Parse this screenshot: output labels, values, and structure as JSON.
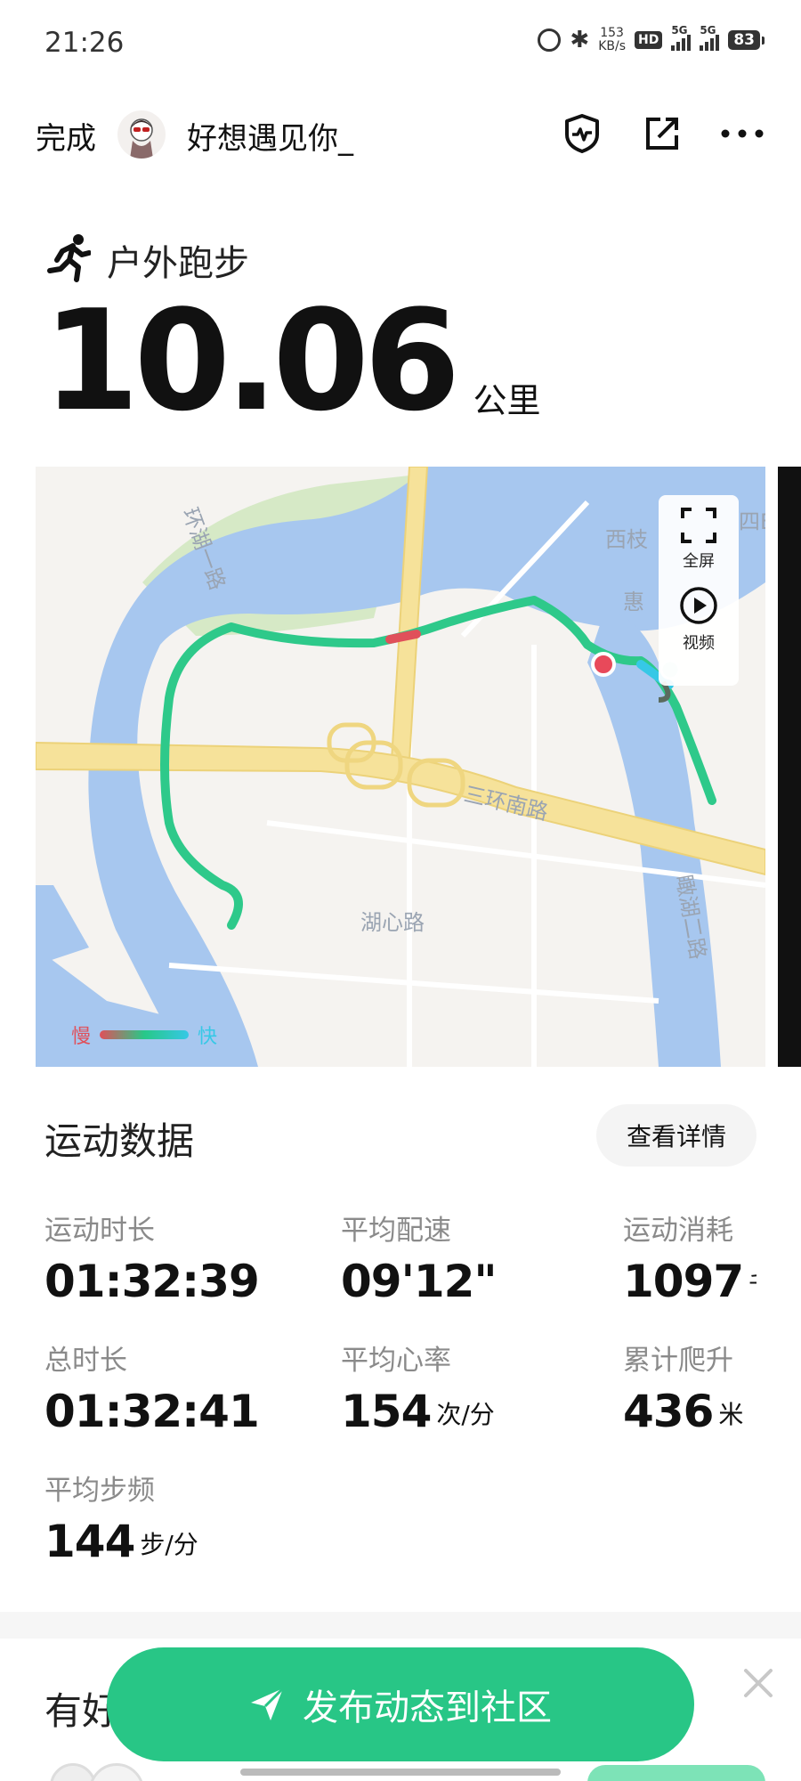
{
  "status_bar": {
    "time": "21:26",
    "speed_value": "153",
    "speed_unit": "KB/s",
    "hd_label": "HD",
    "signal_label": "5G",
    "battery": "83"
  },
  "nav": {
    "done_label": "完成",
    "username": "好想遇见你_"
  },
  "activity": {
    "type_label": "户外跑步",
    "distance": "10.06",
    "distance_unit": "公里"
  },
  "map": {
    "labels": {
      "road_huanhu": "环湖一路",
      "xizhi": "西枝",
      "huizhou_partial": "惠",
      "sanhuan": "三环南路",
      "huxin": "湖心路",
      "kanhu": "瞰湖二路",
      "top_right_partial": "四E"
    },
    "controls": {
      "fullscreen": "全屏",
      "video": "视频"
    },
    "legend": {
      "slow": "慢",
      "fast": "快"
    }
  },
  "stats": {
    "title": "运动数据",
    "details_button": "查看详情",
    "items": [
      {
        "label": "运动时长",
        "value": "01:32:39",
        "unit": ""
      },
      {
        "label": "平均配速",
        "value": "09'12\"",
        "unit": ""
      },
      {
        "label": "运动消耗",
        "value": "1097",
        "unit": "千卡"
      },
      {
        "label": "总时长",
        "value": "01:32:41",
        "unit": ""
      },
      {
        "label": "平均心率",
        "value": "154",
        "unit": "次/分"
      },
      {
        "label": "累计爬升",
        "value": "436",
        "unit": "米"
      },
      {
        "label": "平均步频",
        "value": "144",
        "unit": "步/分"
      }
    ]
  },
  "friends": {
    "title_partial": "有好"
  },
  "publish_button": "发布动态到社区",
  "colors": {
    "accent_green": "#28c686",
    "route_green": "#2ec98a",
    "water": "#a8c8f0",
    "road": "#f7e39a",
    "park": "#d8ebc8"
  }
}
